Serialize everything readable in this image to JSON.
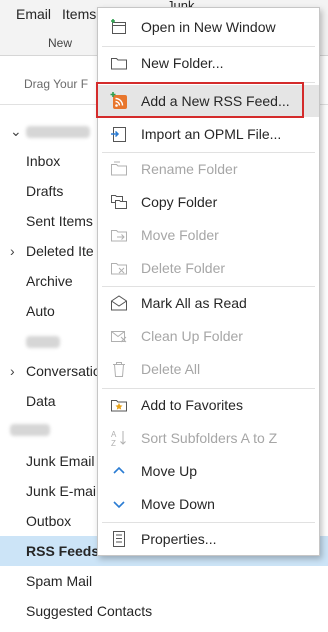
{
  "ribbon": {
    "email_label": "Email",
    "items_label": "Items",
    "group_label": "New",
    "junk_label": "Junk"
  },
  "folder_pane": {
    "drag_hint": "Drag Your F",
    "folders": [
      {
        "label": "Inbox"
      },
      {
        "label": "Drafts"
      },
      {
        "label": "Sent Items"
      },
      {
        "label": "Deleted Ite"
      },
      {
        "label": "Archive"
      },
      {
        "label": "Auto"
      },
      {
        "label": "Conversatio"
      },
      {
        "label": "Data"
      },
      {
        "label": "Junk Email"
      },
      {
        "label": "Junk E-mai"
      },
      {
        "label": "Outbox"
      },
      {
        "label": "RSS Feeds"
      },
      {
        "label": "Spam Mail"
      },
      {
        "label": "Suggested Contacts"
      }
    ]
  },
  "context_menu": {
    "items": [
      {
        "label": "Open in New Window",
        "icon": "new-window-icon",
        "disabled": false
      },
      {
        "label": "New Folder...",
        "icon": "folder-icon",
        "disabled": false
      },
      {
        "label": "Add a New RSS Feed...",
        "icon": "rss-add-icon",
        "disabled": false,
        "highlighted": true
      },
      {
        "label": "Import an OPML File...",
        "icon": "opml-import-icon",
        "disabled": false
      },
      {
        "label": "Rename Folder",
        "icon": "rename-folder-icon",
        "disabled": true
      },
      {
        "label": "Copy Folder",
        "icon": "copy-folder-icon",
        "disabled": false
      },
      {
        "label": "Move Folder",
        "icon": "move-folder-icon",
        "disabled": true
      },
      {
        "label": "Delete Folder",
        "icon": "delete-folder-icon",
        "disabled": true
      },
      {
        "label": "Mark All as Read",
        "icon": "mark-read-icon",
        "disabled": false
      },
      {
        "label": "Clean Up Folder",
        "icon": "clean-up-icon",
        "disabled": true
      },
      {
        "label": "Delete All",
        "icon": "delete-all-icon",
        "disabled": true
      },
      {
        "label": "Add to Favorites",
        "icon": "favorites-icon",
        "disabled": false
      },
      {
        "label": "Sort Subfolders A to Z",
        "icon": "sort-az-icon",
        "disabled": true
      },
      {
        "label": "Move Up",
        "icon": "move-up-icon",
        "disabled": false
      },
      {
        "label": "Move Down",
        "icon": "move-down-icon",
        "disabled": false
      },
      {
        "label": "Properties...",
        "icon": "properties-icon",
        "disabled": false
      }
    ]
  },
  "colors": {
    "accent_blue": "#2b7cd3",
    "rss_orange": "#e8762d",
    "highlight_red": "#d42b2b",
    "selected_folder_bg": "#cce4f7"
  }
}
